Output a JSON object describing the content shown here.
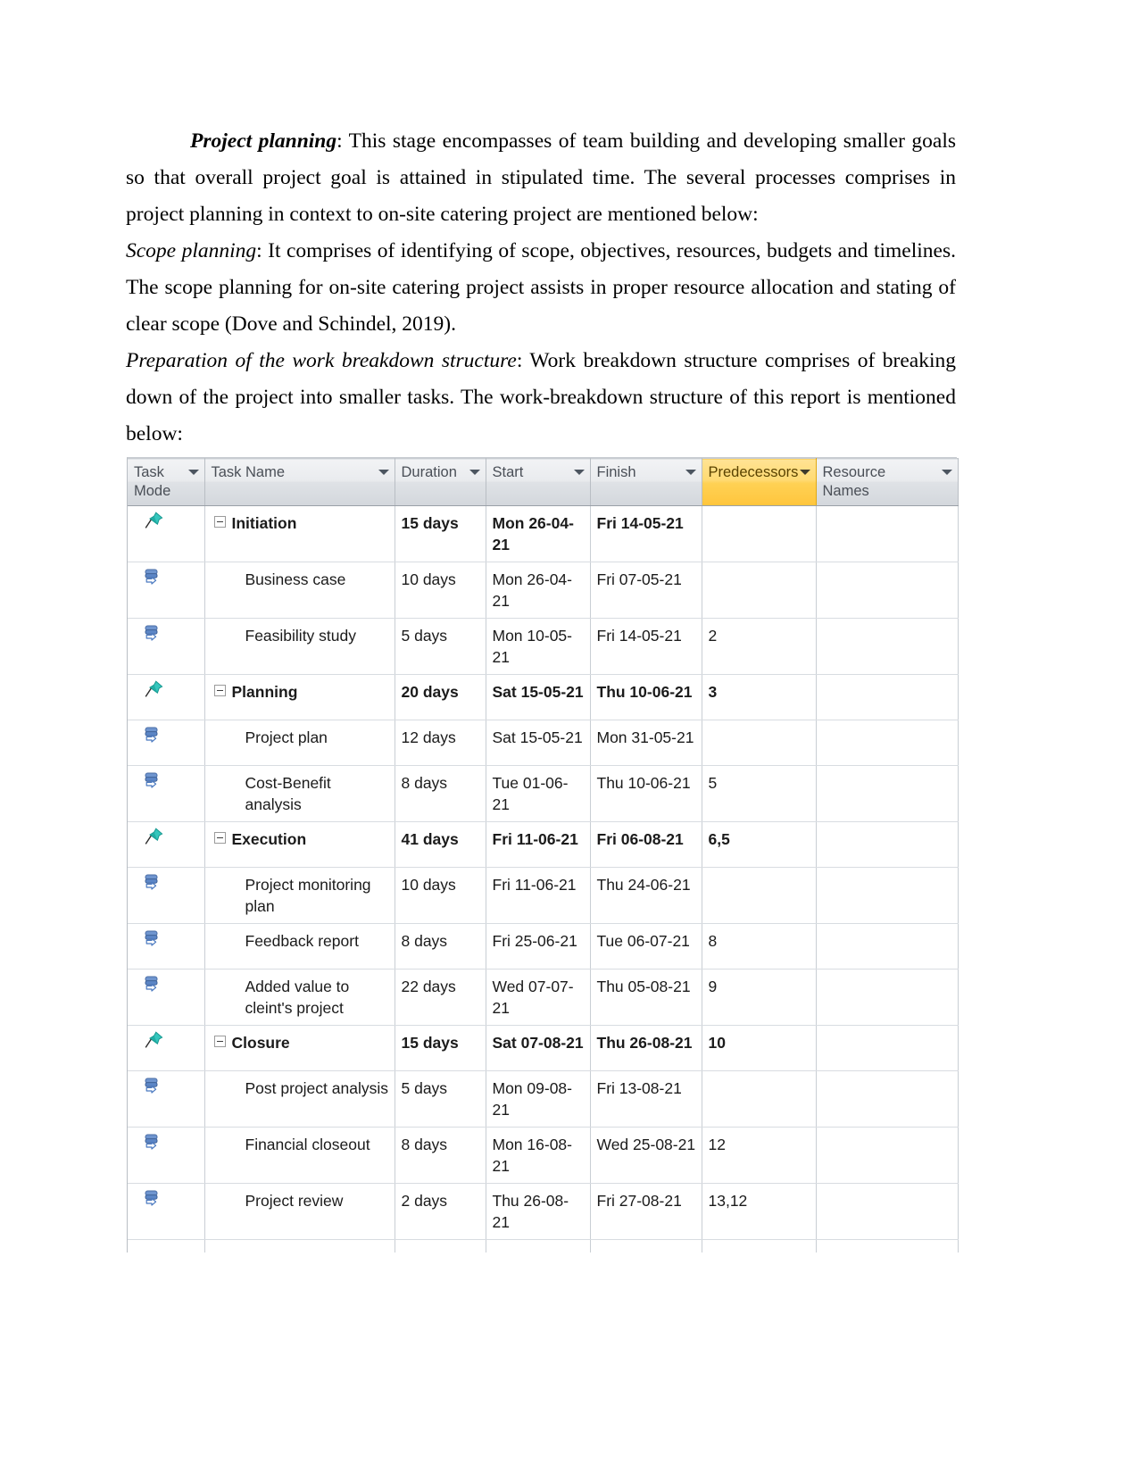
{
  "document": {
    "paragraphs": [
      {
        "id": "p1",
        "indent": true,
        "runs": [
          {
            "style": "bold-italic",
            "text": "Project planning"
          },
          {
            "style": "normal",
            "text": ": This stage encompasses of team building and developing smaller goals so that overall project goal is attained in stipulated time. The several processes comprises in project planning in context to on-site catering project are mentioned below:"
          }
        ]
      },
      {
        "id": "p2",
        "indent": false,
        "runs": [
          {
            "style": "italic",
            "text": "Scope planning"
          },
          {
            "style": "normal",
            "text": ": It comprises of identifying of scope, objectives, resources, budgets and timelines. The scope planning for on-site catering project assists in proper resource allocation and stating of clear scope (Dove and Schindel, 2019)."
          }
        ]
      },
      {
        "id": "p3",
        "indent": false,
        "runs": [
          {
            "style": "italic",
            "text": "Preparation of the work breakdown structure"
          },
          {
            "style": "normal",
            "text": ": Work breakdown structure comprises of breaking down of the project into smaller tasks. The work-breakdown structure of this report is mentioned below:"
          }
        ]
      }
    ]
  },
  "table": {
    "highlight_color": "#ffd154",
    "columns": [
      {
        "key": "mode",
        "label": "Task Mode",
        "sortable": true,
        "highlighted": false
      },
      {
        "key": "name",
        "label": "Task Name",
        "sortable": true,
        "highlighted": false
      },
      {
        "key": "dur",
        "label": "Duration",
        "sortable": true,
        "highlighted": false
      },
      {
        "key": "start",
        "label": "Start",
        "sortable": true,
        "highlighted": false
      },
      {
        "key": "finish",
        "label": "Finish",
        "sortable": true,
        "highlighted": false
      },
      {
        "key": "pred",
        "label": "Predecessors",
        "sortable": true,
        "highlighted": true
      },
      {
        "key": "res",
        "label": "Resource Names",
        "sortable": true,
        "highlighted": false
      }
    ],
    "rows": [
      {
        "mode_icon": "manually-scheduled-pin-icon",
        "summary": true,
        "name": "Initiation",
        "duration": "15 days",
        "start": "Mon 26-04-21",
        "finish": "Fri 14-05-21",
        "predecessors": "",
        "resources": ""
      },
      {
        "mode_icon": "auto-scheduled-icon",
        "summary": false,
        "name": "Business case",
        "duration": "10 days",
        "start": "Mon 26-04-21",
        "finish": "Fri 07-05-21",
        "predecessors": "",
        "resources": ""
      },
      {
        "mode_icon": "auto-scheduled-icon",
        "summary": false,
        "name": "Feasibility study",
        "duration": "5 days",
        "start": "Mon 10-05-21",
        "finish": "Fri 14-05-21",
        "predecessors": "2",
        "resources": ""
      },
      {
        "mode_icon": "manually-scheduled-pin-icon",
        "summary": true,
        "name": "Planning",
        "duration": "20 days",
        "start": "Sat 15-05-21",
        "finish": "Thu 10-06-21",
        "predecessors": "3",
        "resources": ""
      },
      {
        "mode_icon": "auto-scheduled-icon",
        "summary": false,
        "name": "Project plan",
        "duration": "12 days",
        "start": "Sat 15-05-21",
        "finish": "Mon 31-05-21",
        "predecessors": "",
        "resources": ""
      },
      {
        "mode_icon": "auto-scheduled-icon",
        "summary": false,
        "name": "Cost-Benefit analysis",
        "duration": "8 days",
        "start": "Tue 01-06-21",
        "finish": "Thu 10-06-21",
        "predecessors": "5",
        "resources": ""
      },
      {
        "mode_icon": "manually-scheduled-pin-icon",
        "summary": true,
        "name": "Execution",
        "duration": "41 days",
        "start": "Fri 11-06-21",
        "finish": "Fri 06-08-21",
        "predecessors": "6,5",
        "resources": ""
      },
      {
        "mode_icon": "auto-scheduled-icon",
        "summary": false,
        "name": "Project monitoring plan",
        "duration": "10 days",
        "start": "Fri 11-06-21",
        "finish": "Thu 24-06-21",
        "predecessors": "",
        "resources": ""
      },
      {
        "mode_icon": "auto-scheduled-icon",
        "summary": false,
        "name": "Feedback report",
        "duration": "8 days",
        "start": "Fri 25-06-21",
        "finish": "Tue 06-07-21",
        "predecessors": "8",
        "resources": ""
      },
      {
        "mode_icon": "auto-scheduled-icon",
        "summary": false,
        "name": "Added value to cleint's project",
        "duration": "22 days",
        "start": "Wed 07-07-21",
        "finish": "Thu 05-08-21",
        "predecessors": "9",
        "resources": ""
      },
      {
        "mode_icon": "manually-scheduled-pin-icon",
        "summary": true,
        "name": "Closure",
        "duration": "15 days",
        "start": "Sat 07-08-21",
        "finish": "Thu 26-08-21",
        "predecessors": "10",
        "resources": ""
      },
      {
        "mode_icon": "auto-scheduled-icon",
        "summary": false,
        "name": "Post project analysis",
        "duration": "5 days",
        "start": "Mon 09-08-21",
        "finish": "Fri 13-08-21",
        "predecessors": "",
        "resources": ""
      },
      {
        "mode_icon": "auto-scheduled-icon",
        "summary": false,
        "name": "Financial closeout",
        "duration": "8 days",
        "start": "Mon 16-08-21",
        "finish": "Wed 25-08-21",
        "predecessors": "12",
        "resources": ""
      },
      {
        "mode_icon": "auto-scheduled-icon",
        "summary": false,
        "name": "Project review",
        "duration": "2 days",
        "start": "Thu 26-08-21",
        "finish": "Fri 27-08-21",
        "predecessors": "13,12",
        "resources": ""
      }
    ]
  }
}
